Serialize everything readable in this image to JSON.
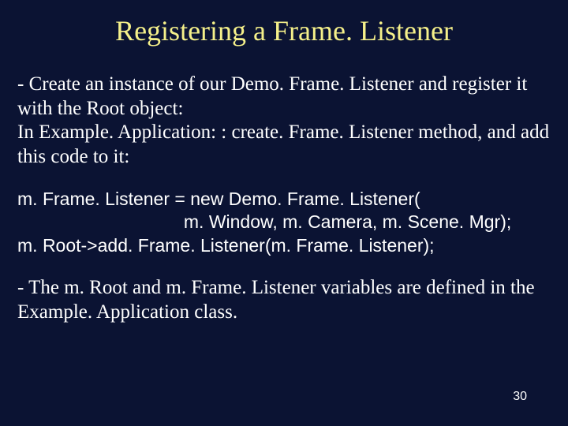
{
  "title": "Registering a Frame. Listener",
  "para1": "- Create an instance of our Demo. Frame. Listener and register it with the Root object:\nIn Example. Application: : create. Frame. Listener method, and add this code to it:",
  "code": "m. Frame. Listener = new Demo. Frame. Listener(\n                                 m. Window, m. Camera, m. Scene. Mgr);\nm. Root->add. Frame. Listener(m. Frame. Listener);",
  "para3": "- The m. Root and m. Frame. Listener variables are defined in the Example. Application class.",
  "pageNumber": "30"
}
